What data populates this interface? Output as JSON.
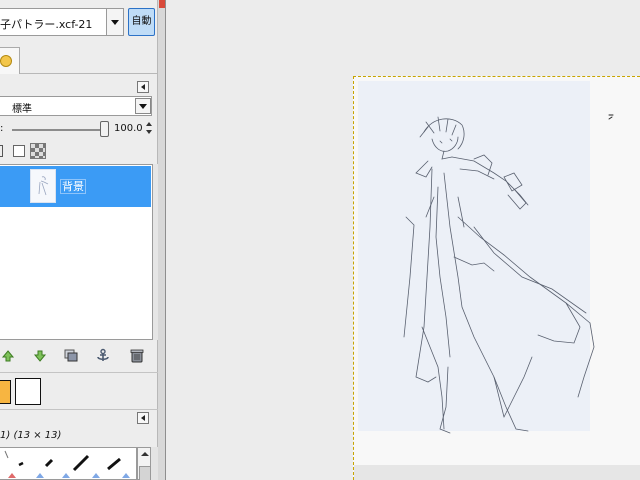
{
  "image_selector": {
    "value": "子パトラー.xcf-21"
  },
  "auto_button": {
    "label": "自動"
  },
  "layers": {
    "mode": "標準",
    "opacity_label": ":",
    "opacity_value": "100.0",
    "opacity": 1.0,
    "items": [
      {
        "name": "背景",
        "selected": true
      }
    ]
  },
  "brushes": {
    "info": "1) (13 × 13)"
  },
  "colors": {
    "foreground": "#f7b541",
    "background": "#ffffff",
    "selection": "#3b9bf5",
    "auto_button_fill": "#bfdcf7"
  },
  "icons": {
    "layer_raise": "arrow-up-icon",
    "layer_lower": "arrow-down-icon",
    "layer_duplicate": "duplicate-icon",
    "layer_anchor": "anchor-icon",
    "layer_delete": "trash-icon"
  }
}
